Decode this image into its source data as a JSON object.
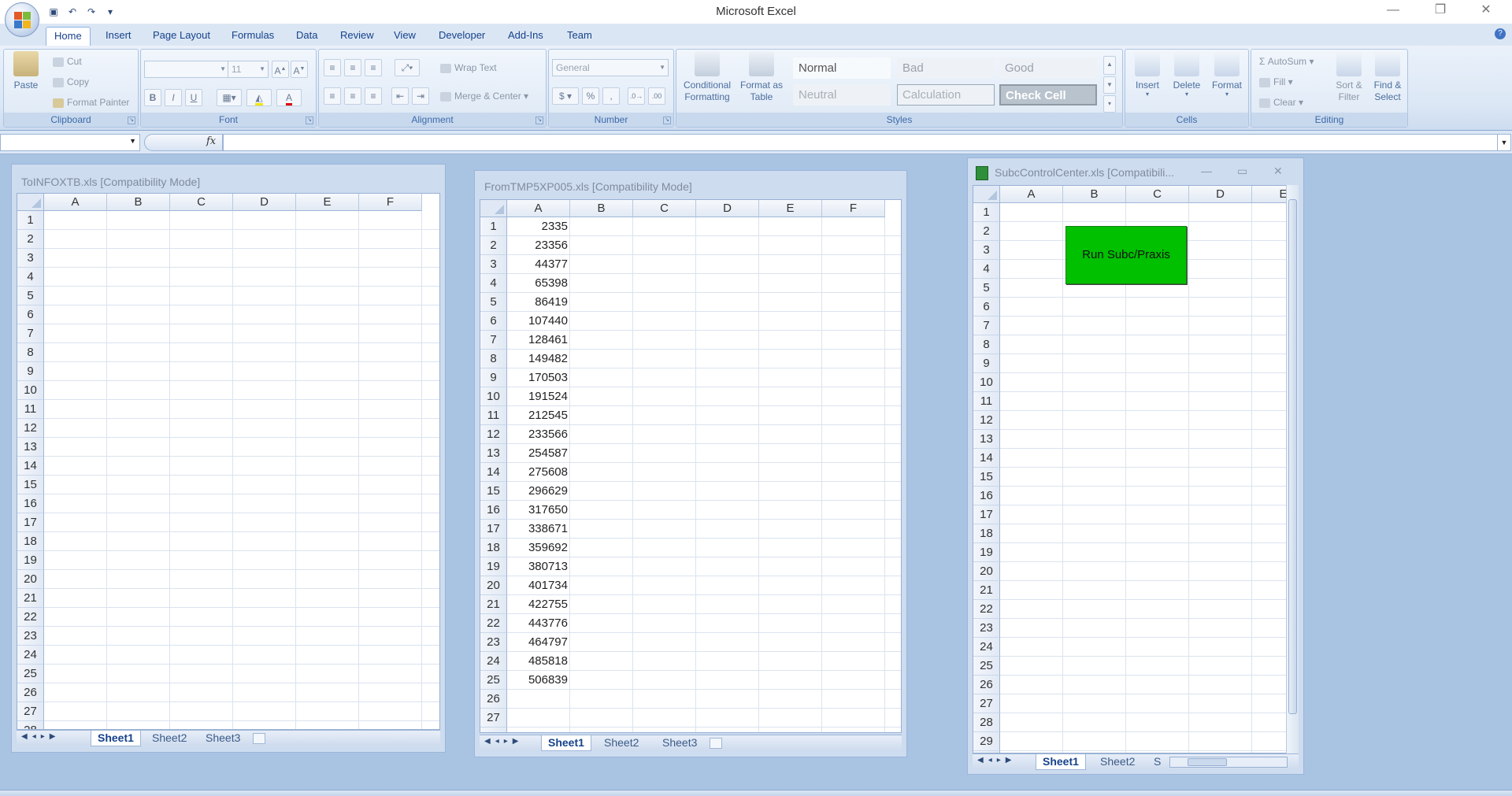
{
  "app": {
    "title": "Microsoft Excel"
  },
  "ribbon_tabs": [
    "Home",
    "Insert",
    "Page Layout",
    "Formulas",
    "Data",
    "Review",
    "View",
    "Developer",
    "Add-Ins",
    "Team"
  ],
  "clipboard": {
    "paste": "Paste",
    "cut": "Cut",
    "copy": "Copy",
    "format_painter": "Format Painter",
    "label": "Clipboard"
  },
  "font": {
    "size": "11",
    "label": "Font",
    "bold": "B",
    "italic": "I",
    "underline": "U"
  },
  "alignment": {
    "wrap_text": "Wrap Text",
    "merge_center": "Merge & Center",
    "label": "Alignment"
  },
  "number": {
    "format": "General",
    "currency": "$",
    "percent": "%",
    "comma": ",",
    "label": "Number"
  },
  "styles": {
    "conditional": "Conditional Formatting",
    "format_table": "Format as Table",
    "normal": "Normal",
    "bad": "Bad",
    "good": "Good",
    "neutral": "Neutral",
    "calculation": "Calculation",
    "check_cell": "Check Cell",
    "label": "Styles"
  },
  "cells": {
    "insert": "Insert",
    "delete": "Delete",
    "format": "Format",
    "label": "Cells"
  },
  "editing": {
    "autosum": "AutoSum",
    "fill": "Fill",
    "clear": "Clear",
    "sort_filter": "Sort & Filter",
    "find_select": "Find & Select",
    "label": "Editing"
  },
  "formula_bar": {
    "fx": "fx",
    "name_box": "",
    "value": ""
  },
  "workbooks": [
    {
      "title": "ToINFOXTB.xls  [Compatibility Mode]",
      "columns": [
        "A",
        "B",
        "C",
        "D",
        "E",
        "F"
      ],
      "sheets": [
        "Sheet1",
        "Sheet2",
        "Sheet3"
      ]
    },
    {
      "title": "FromTMP5XP005.xls  [Compatibility Mode]",
      "columns": [
        "A",
        "B",
        "C",
        "D",
        "E",
        "F"
      ],
      "values_col_a": [
        "2335",
        "23356",
        "44377",
        "65398",
        "86419",
        "107440",
        "128461",
        "149482",
        "170503",
        "191524",
        "212545",
        "233566",
        "254587",
        "275608",
        "296629",
        "317650",
        "338671",
        "359692",
        "380713",
        "401734",
        "422755",
        "443776",
        "464797",
        "485818",
        "506839"
      ],
      "sheets": [
        "Sheet1",
        "Sheet2",
        "Sheet3"
      ]
    },
    {
      "title": "SubcControlCenter.xls  [Compatibili...",
      "columns": [
        "A",
        "B",
        "C",
        "D",
        "E"
      ],
      "button_label": "Run Subc/Praxis",
      "sheets": [
        "Sheet1",
        "Sheet2",
        "S"
      ]
    }
  ],
  "colors": {
    "run_button": "#00c000",
    "accent": "#15428b"
  }
}
